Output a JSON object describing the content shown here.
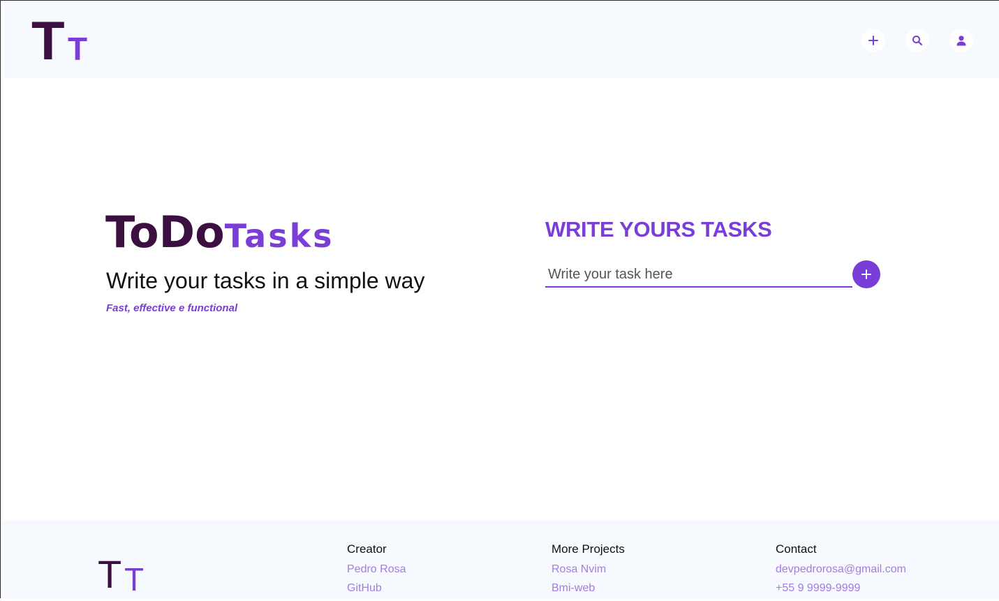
{
  "header": {
    "logo": {
      "big": "T",
      "small": "T"
    },
    "icons": [
      "plus-icon",
      "search-icon",
      "user-icon"
    ]
  },
  "hero": {
    "title_part1": "ToDo",
    "title_part2": "Tasks",
    "subtitle": "Write your tasks in a simple way",
    "tagline": "Fast, effective e functional"
  },
  "task_form": {
    "title": "WRITE YOURS TASKS",
    "placeholder": "Write your task here",
    "value": "",
    "add_icon": "plus-icon"
  },
  "footer": {
    "logo": {
      "big": "T",
      "small": "T"
    },
    "columns": [
      {
        "heading": "Creator",
        "links": [
          "Pedro Rosa",
          "GitHub"
        ]
      },
      {
        "heading": "More Projects",
        "links": [
          "Rosa Nvim",
          "Bmi-web"
        ]
      },
      {
        "heading": "Contact",
        "links": [
          "devpedrorosa@gmail.com",
          "+55 9 9999-9999"
        ]
      }
    ]
  },
  "colors": {
    "primary": "#7a3ed6",
    "dark": "#3b0f40",
    "panel": "#f6f9fd",
    "link": "#a47de0"
  }
}
